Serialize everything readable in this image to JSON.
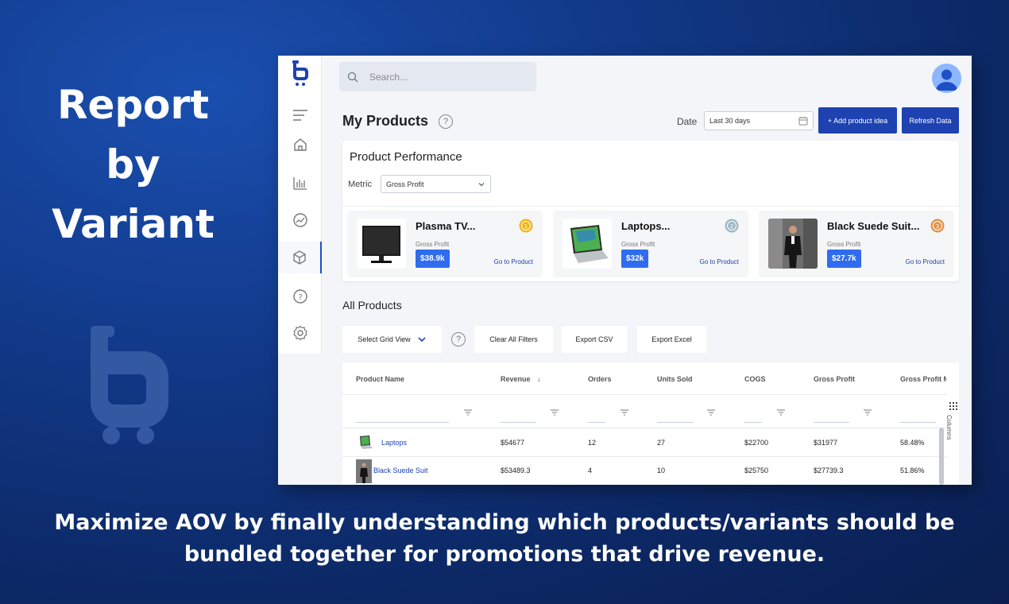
{
  "hero": {
    "title_line1": "Report",
    "title_line2": "by",
    "title_line3": "Variant",
    "caption_line1": "Maximize AOV by finally understanding which products/variants should be",
    "caption_line2": "bundled together for promotions that drive revenue."
  },
  "app": {
    "search_placeholder": "Search...",
    "page_title": "My Products",
    "help_glyph": "?",
    "date_label": "Date",
    "date_value": "Last 30 days",
    "add_button": "+ Add product idea",
    "refresh_button": "Refresh Data",
    "sidebar_icons": [
      "menu-icon",
      "home-icon",
      "bar-chart-icon",
      "analytics-icon",
      "box-icon",
      "help-icon",
      "settings-icon"
    ],
    "colors": {
      "primary": "#1e42b0",
      "badge": "#2f6cef",
      "link": "#1e42b0"
    }
  },
  "performance": {
    "title": "Product Performance",
    "metric_label": "Metric",
    "metric_value": "Gross Profit",
    "products": [
      {
        "name": "Plasma TV...",
        "metric": "Gross Profit",
        "value": "$38.9k",
        "link": "Go to Product",
        "medal": "gold"
      },
      {
        "name": "Laptops...",
        "metric": "Gross Profit",
        "value": "$32k",
        "link": "Go to Product",
        "medal": "silver"
      },
      {
        "name": "Black Suede Suit...",
        "metric": "Gross Profit",
        "value": "$27.7k",
        "link": "Go to Product",
        "medal": "bronze"
      }
    ]
  },
  "all_products": {
    "title": "All Products",
    "grid_view": "Select Grid View",
    "clear_filters": "Clear All Filters",
    "export_csv": "Export CSV",
    "export_excel": "Export Excel",
    "columns_tab": "Columns",
    "headers": [
      "Product Name",
      "Revenue",
      "Orders",
      "Units Sold",
      "COGS",
      "Gross Profit",
      "Gross Profit M"
    ],
    "sort_glyph": "↓",
    "rows": [
      {
        "name": "Laptops",
        "revenue": "$54677",
        "orders": "12",
        "units": "27",
        "cogs": "$22700",
        "gross_profit": "$31977",
        "margin": "58.48%"
      },
      {
        "name": "Black Suede Suit",
        "revenue": "$53489.3",
        "orders": "4",
        "units": "10",
        "cogs": "$25750",
        "gross_profit": "$27739.3",
        "margin": "51.86%"
      }
    ]
  }
}
